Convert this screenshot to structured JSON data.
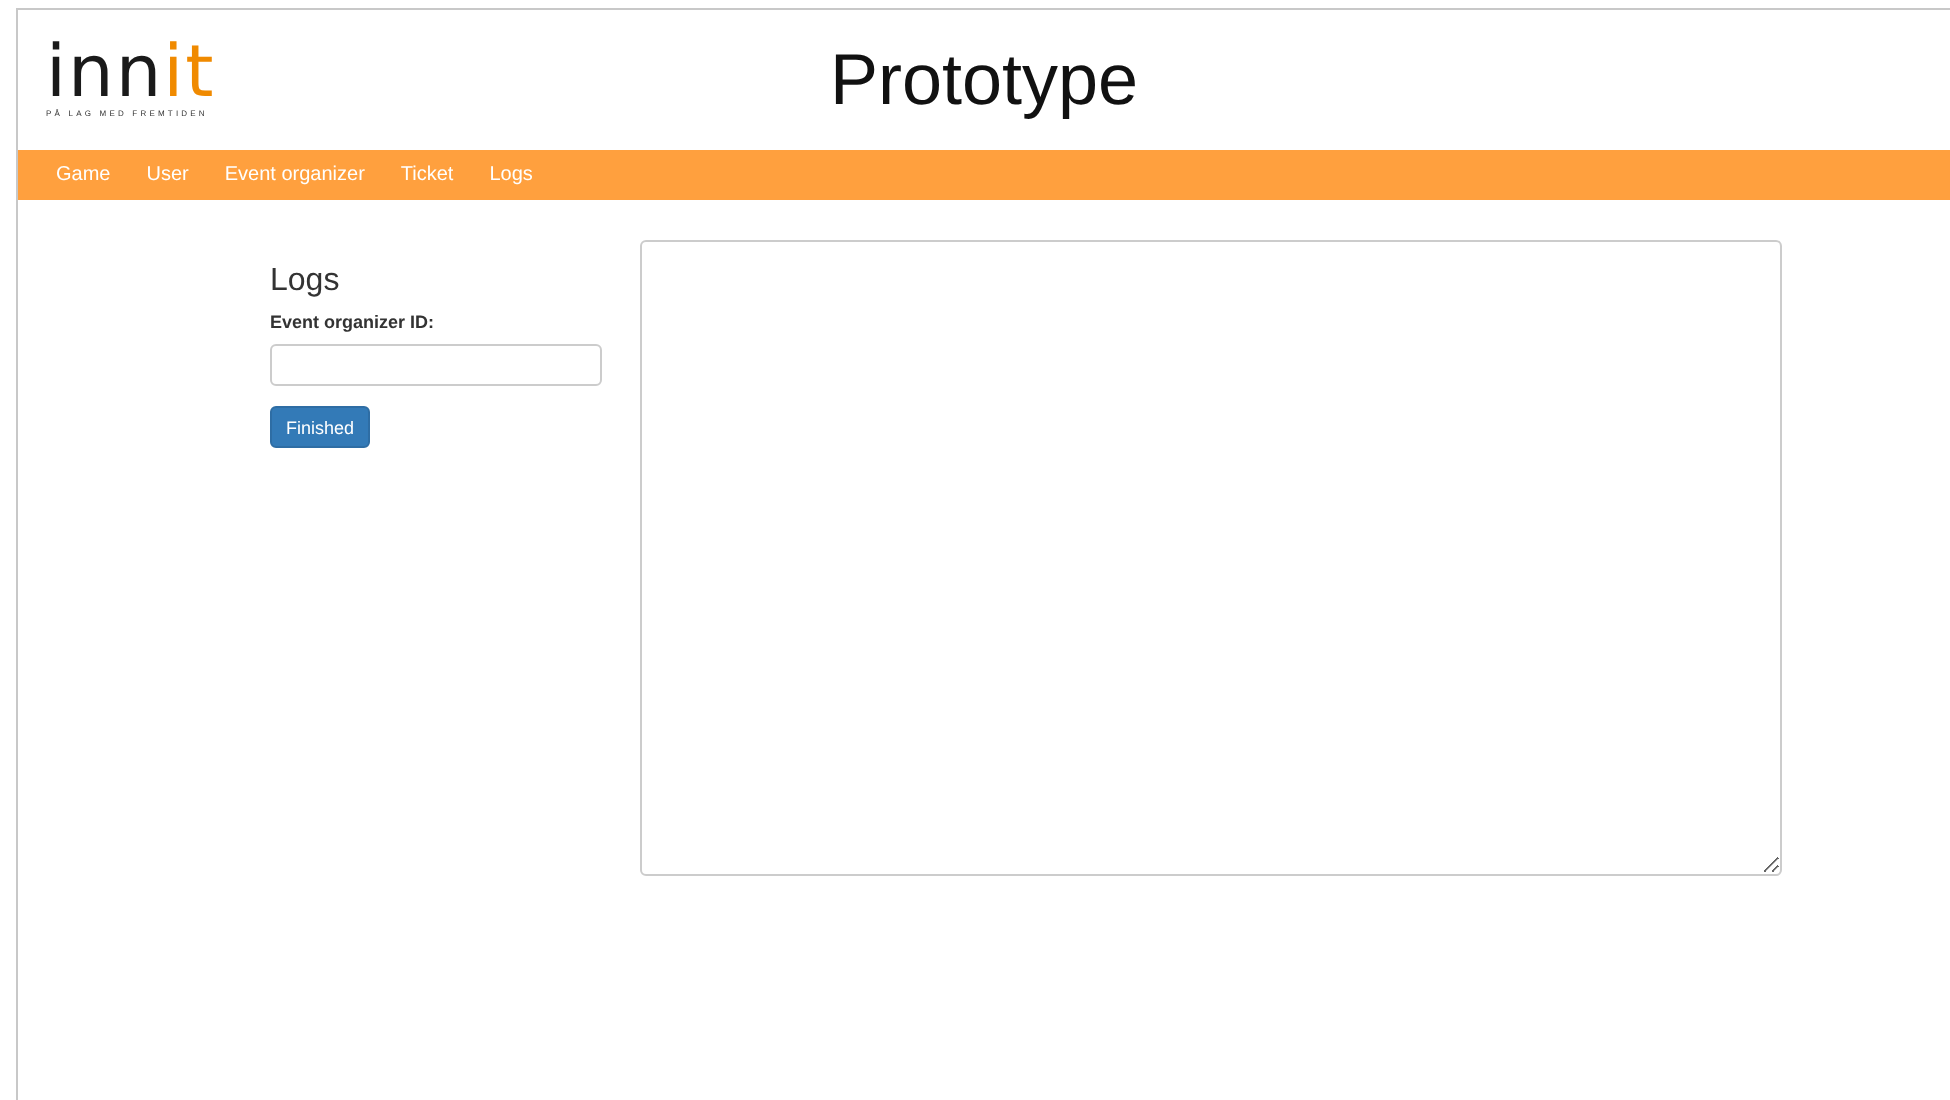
{
  "header": {
    "logo": {
      "main": "inn",
      "accent": "it",
      "tagline": "PÅ LAG MED FREMTIDEN"
    },
    "title": "Prototype"
  },
  "nav": {
    "items": [
      {
        "label": "Game"
      },
      {
        "label": "User"
      },
      {
        "label": "Event organizer"
      },
      {
        "label": "Ticket"
      },
      {
        "label": "Logs"
      }
    ]
  },
  "form": {
    "heading": "Logs",
    "field_label": "Event organizer ID:",
    "button": "Finished"
  },
  "log_output": {
    "kind": "textarea"
  }
}
